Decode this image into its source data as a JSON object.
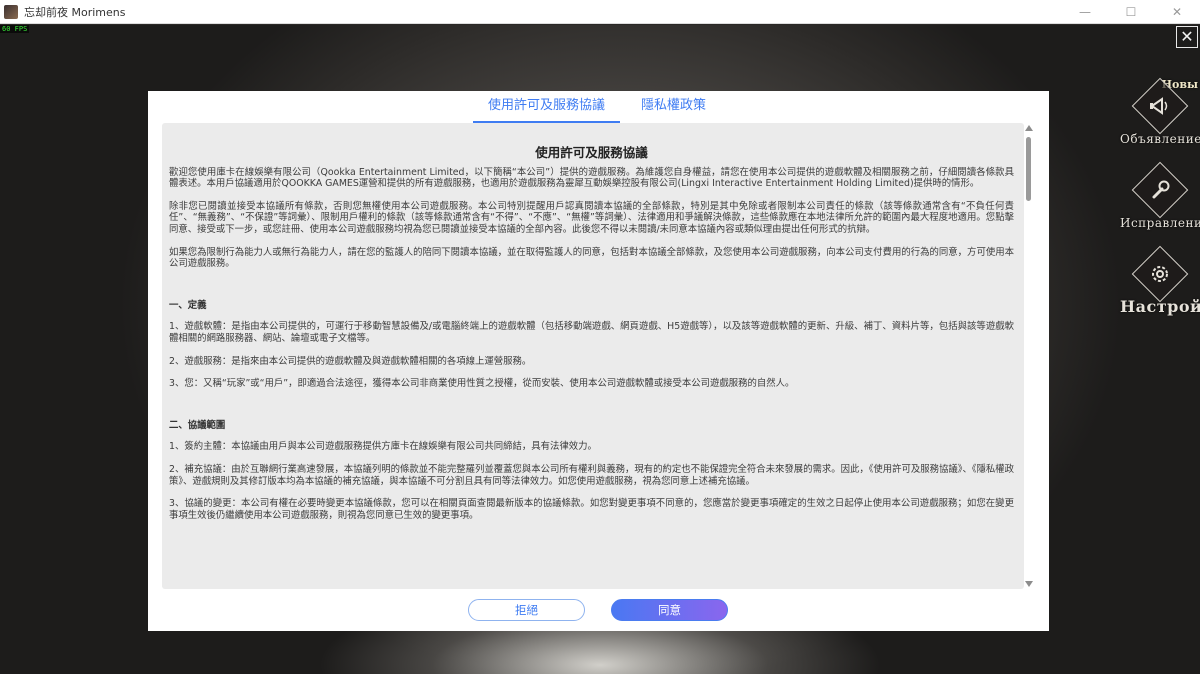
{
  "window": {
    "title": "忘却前夜 Morimens",
    "minimize": "—",
    "maximize": "☐",
    "close": "✕"
  },
  "overlay": {
    "fps": "60 FPS"
  },
  "game_ui": {
    "close": "✕",
    "new_badge": "Новы",
    "sidebar": [
      {
        "label": "Объявление",
        "icon": "megaphone-icon"
      },
      {
        "label": "Исправление",
        "icon": "wrench-icon"
      },
      {
        "label": "Настройк",
        "icon": "gear-icon"
      }
    ]
  },
  "modal": {
    "tabs": [
      {
        "label": "使用許可及服務協議",
        "active": true
      },
      {
        "label": "隱私權政策",
        "active": false
      }
    ],
    "doc": {
      "title": "使用許可及服務協議",
      "intro": [
        "歡迎您使用庫卡在線娛樂有限公司（Qookka Entertainment Limited，以下簡稱“本公司”）提供的遊戲服務。為維護您自身權益，請您在使用本公司提供的遊戲軟體及相關服務之前，仔細閱讀各條款具體表述。本用戶協議適用於QOOKKA GAMES運營和提供的所有遊戲服務，也適用於遊戲服務為靈犀互動娛樂控股有限公司(Lingxi Interactive Entertainment Holding Limited)提供時的情形。",
        "除非您已閱讀並接受本協議所有條款，否則您無權使用本公司遊戲服務。本公司特別提醒用戶認真閱讀本協議的全部條款，特別是其中免除或者限制本公司責任的條款（該等條款通常含有“不負任何責任”、“無義務”、“不保證”等詞彙）、限制用戶權利的條款（該等條款通常含有“不得”、“不應”、“無權”等詞彙）、法律適用和爭議解決條款，這些條款應在本地法律所允許的範圍內最大程度地適用。您點擊同意、接受或下一步，或您註冊、使用本公司遊戲服務均視為您已閱讀並接受本協議的全部內容。此後您不得以未閱讀/未同意本協議內容或類似理由提出任何形式的抗辯。",
        "如果您為限制行為能力人或無行為能力人，請在您的監護人的陪同下閱讀本協議，並在取得監護人的同意，包括對本協議全部條款，及您使用本公司遊戲服務，向本公司支付費用的行為的同意，方可使用本公司遊戲服務。"
      ],
      "sections": [
        {
          "title": "一、定義",
          "items": [
            "1、遊戲軟體：是指由本公司提供的，可運行于移動智慧設備及/或電腦終端上的遊戲軟體（包括移動端遊戲、網頁遊戲、H5遊戲等），以及該等遊戲軟體的更新、升級、補丁、資料片等，包括與該等遊戲軟體相關的網路服務器、網站、論壇或電子文檔等。",
            "2、遊戲服務：是指來由本公司提供的遊戲軟體及與遊戲軟體相關的各項線上運營服務。",
            "3、您：又稱“玩家”或“用戶”，即適過合法途徑，獲得本公司非商業使用性質之授權，從而安裝、使用本公司遊戲軟體或接受本公司遊戲服務的自然人。"
          ]
        },
        {
          "title": "二、協議範圍",
          "items": [
            "1、簽約主體：本協議由用戶與本公司遊戲服務提供方庫卡在線娛樂有限公司共同締結，具有法律效力。",
            "2、補充協議：由於互聯網行業高速發展，本協議列明的條款並不能完整羅列並覆蓋您與本公司所有權利與義務，現有的約定也不能保證完全符合未來發展的需求。因此，《使用許可及服務協議》、《隱私權政策》、遊戲規則及其修訂版本均為本協議的補充協議，與本協議不可分割且具有同等法律效力。如您使用遊戲服務，視為您同意上述補充協議。",
            "3、協議的變更：本公司有權在必要時變更本協議條款，您可以在相關頁面查閱最新版本的協議條款。如您對變更事項不同意的，您應當於變更事項確定的生效之日起停止使用本公司遊戲服務；如您在變更事項生效後仍繼續使用本公司遊戲服務，則視為您同意已生效的變更事項。"
          ]
        }
      ]
    },
    "buttons": {
      "reject": "拒絕",
      "agree": "同意"
    }
  }
}
